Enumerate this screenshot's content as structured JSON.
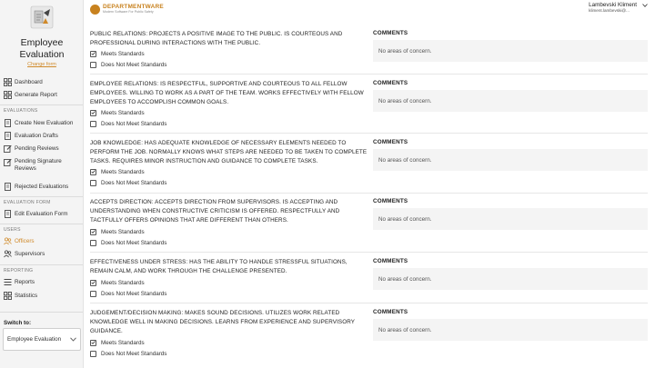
{
  "sidebar": {
    "app_title": "Employee Evaluation",
    "change_link": "Change form",
    "nav": {
      "dashboard": "Dashboard",
      "generate_report": "Generate Report",
      "create_new": "Create New Evaluation",
      "drafts": "Evaluation Drafts",
      "pending_reviews": "Pending Reviews",
      "pending_signature": "Pending Signature Reviews",
      "rejected": "Rejected Evaluations",
      "edit_form": "Edit Evaluation Form",
      "officers": "Officers",
      "supervisors": "Supervisors",
      "reports": "Reports",
      "statistics": "Statistics"
    },
    "sections": {
      "evaluations": "EVALUATIONS",
      "evaluation_form": "EVALUATION FORM",
      "users": "USERS",
      "reporting": "REPORTING"
    },
    "switch_label": "Switch to:",
    "switch_value": "Employee Evaluation"
  },
  "header": {
    "brand_name": "DEPARTMENTWARE",
    "brand_tag": "Modern Software For Public Safety",
    "user_name": "Lambevski Kliment",
    "user_email": "kliment.lambevski@..."
  },
  "options": {
    "meets": "Meets Standards",
    "not_meets": "Does Not Meet Standards"
  },
  "comments_label": "COMMENTS",
  "questions": [
    {
      "text": "PUBLIC RELATIONS: PROJECTS A POSITIVE IMAGE TO THE PUBLIC. IS COURTEOUS AND PROFESSIONAL DURING INTERACTIONS WITH THE PUBLIC.",
      "comment": "No areas of concern.",
      "meets": true
    },
    {
      "text": "EMPLOYEE RELATIONS: IS RESPECTFUL, SUPPORTIVE AND COURTEOUS TO ALL FELLOW EMPLOYEES. WILLING TO WORK AS A PART OF THE TEAM. WORKS EFFECTIVELY WITH FELLOW EMPLOYEES TO ACCOMPLISH COMMON GOALS.",
      "comment": "No areas of concern.",
      "meets": true
    },
    {
      "text": "JOB KNOWLEDGE: HAS ADEQUATE KNOWLEDGE OF NECESSARY ELEMENTS NEEDED TO PERFORM THE JOB. NORMALLY KNOWS WHAT STEPS ARE NEEDED TO BE TAKEN TO COMPLETE TASKS. REQUIRES MINOR INSTRUCTION AND GUIDANCE TO COMPLETE TASKS.",
      "comment": "No areas of concern.",
      "meets": true
    },
    {
      "text": "ACCEPTS DIRECTION: ACCEPTS DIRECTION FROM SUPERVISORS. IS ACCEPTING AND UNDERSTANDING WHEN CONSTRUCTIVE CRITICISM IS OFFERED. RESPECTFULLY AND TACTFULLY OFFERS OPINIONS THAT ARE DIFFERENT THAN OTHERS.",
      "comment": "No areas of concern.",
      "meets": true
    },
    {
      "text": "EFFECTIVENESS UNDER STRESS: HAS THE ABILITY TO HANDLE STRESSFUL SITUATIONS, REMAIN CALM, AND WORK THROUGH THE CHALLENGE PRESENTED.",
      "comment": "No areas of concern.",
      "meets": true
    },
    {
      "text": "JUDGEMENT/DECISION MAKING: MAKES SOUND DECISIONS. UTILIZES WORK RELATED KNOWLEDGE WELL IN MAKING DECISIONS. LEARNS FROM EXPERIENCE AND SUPERVISORY GUIDANCE.",
      "comment": "No areas of concern.",
      "meets": true
    }
  ]
}
